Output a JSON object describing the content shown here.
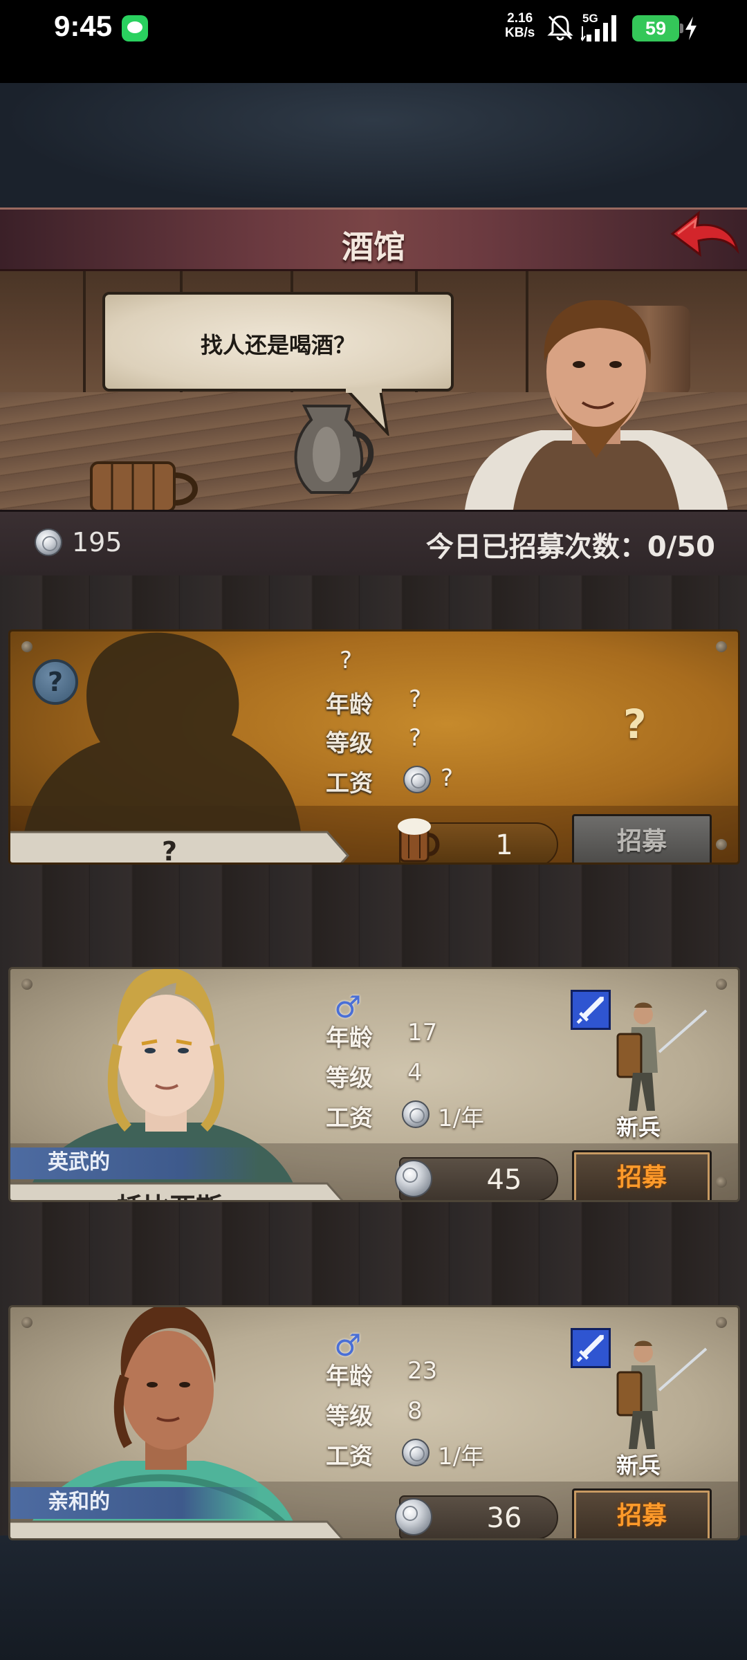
{
  "status_bar": {
    "time": "9:45",
    "net_speed_value": "2.16",
    "net_speed_unit": "KB/s",
    "network": "5G",
    "battery": "59",
    "icons": [
      "message-icon",
      "mute-icon",
      "signal-icon",
      "battery-icon",
      "charging-icon"
    ]
  },
  "header": {
    "title": "酒馆",
    "back_icon": "back-arrow-icon"
  },
  "tavern": {
    "speech": "找人还是喝酒？"
  },
  "info": {
    "silver": "195",
    "recruit_count": "今日已招募次数：0/50"
  },
  "labels": {
    "age": "年龄",
    "level": "等级",
    "salary": "工资"
  },
  "cards": [
    {
      "type": "unknown",
      "gender": "?",
      "age": "?",
      "level": "?",
      "salary": "?",
      "class": "?",
      "name": "?",
      "cost": "1",
      "cost_icon": "beer-mug-icon",
      "button": "招募",
      "button_enabled": false
    },
    {
      "type": "hero",
      "gender": "♂",
      "age": "17",
      "level": "4",
      "salary": "1/年",
      "class": "新兵",
      "class_icon": "sword-icon",
      "trait": "英武的",
      "name": "托比亚斯",
      "cost": "45",
      "cost_icon": "silver-coin-icon",
      "button": "招募",
      "button_enabled": true
    },
    {
      "type": "hero",
      "gender": "♂",
      "age": "23",
      "level": "8",
      "salary": "1/年",
      "class": "新兵",
      "class_icon": "sword-icon",
      "trait": "亲和的",
      "name": "",
      "cost": "36",
      "cost_icon": "silver-coin-icon",
      "button": "招募",
      "button_enabled": true
    }
  ],
  "colors": {
    "accent_orange": "#ff9a2a",
    "title_bar": "#6b3a40",
    "battery_green": "#34c759",
    "gender_blue": "#4a6fd6",
    "trait_blue": "#4e6ca2"
  }
}
